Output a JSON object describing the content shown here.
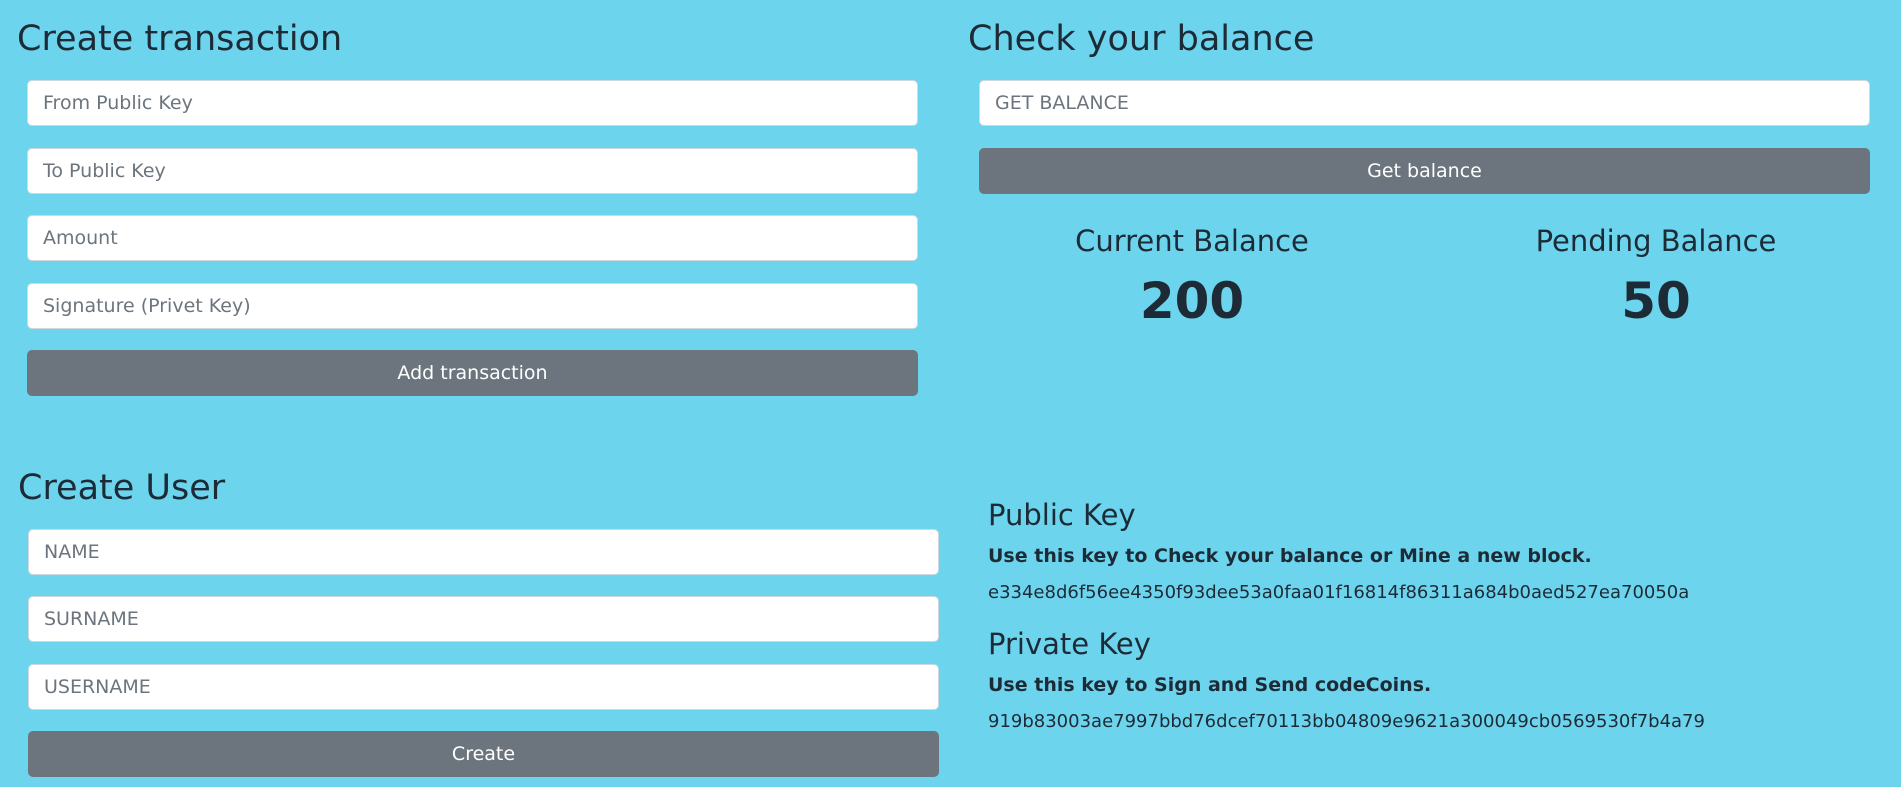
{
  "create_transaction": {
    "title": "Create transaction",
    "from_placeholder": "From Public Key",
    "to_placeholder": "To Public Key",
    "amount_placeholder": "Amount",
    "signature_placeholder": "Signature (Privet Key)",
    "submit_label": "Add transaction"
  },
  "check_balance": {
    "title": "Check your balance",
    "input_placeholder": "GET BALANCE",
    "button_label": "Get balance",
    "current_label": "Current Balance",
    "current_value": "200",
    "pending_label": "Pending Balance",
    "pending_value": "50"
  },
  "create_user": {
    "title": "Create User",
    "name_placeholder": "NAME",
    "surname_placeholder": "SURNAME",
    "username_placeholder": "USERNAME",
    "button_label": "Create"
  },
  "keys": {
    "public_title": "Public Key",
    "public_desc": "Use this key to Check your balance or Mine a new block.",
    "public_value": "e334e8d6f56ee4350f93dee53a0faa01f16814f86311a684b0aed527ea70050a",
    "private_title": "Private Key",
    "private_desc": "Use this key to Sign and Send codeCoins.",
    "private_value": "919b83003ae7997bbd76dcef70113bb04809e9621a300049cb0569530f7b4a79"
  },
  "colors": {
    "background": "#6dd4ee",
    "button": "#6c757d",
    "text": "#1d2b36"
  }
}
